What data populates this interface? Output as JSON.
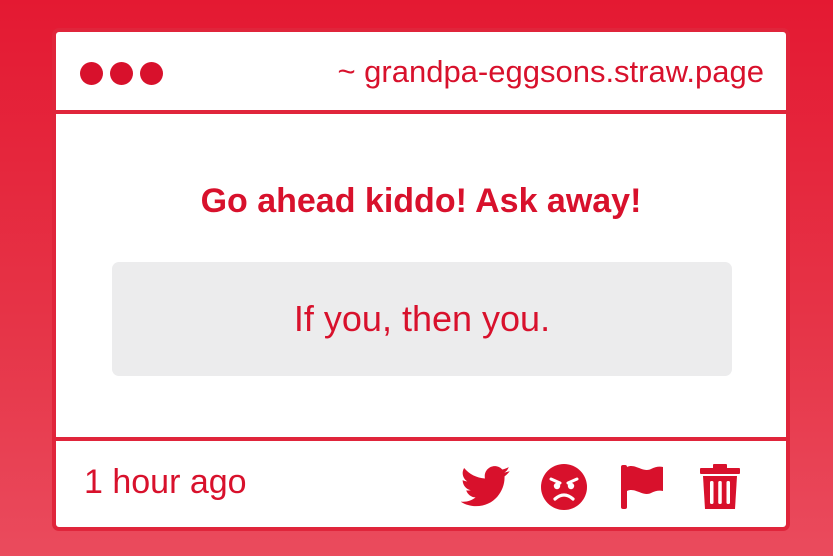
{
  "window": {
    "url": "~ grandpa-eggsons.straw.page",
    "dots": [
      "red",
      "red",
      "red"
    ]
  },
  "main": {
    "prompt": "Go ahead kiddo! Ask away!",
    "question": "If you, then you."
  },
  "footer": {
    "time": "1 hour ago",
    "actions": [
      "twitter-icon",
      "angry-face-icon",
      "flag-icon",
      "trash-icon"
    ]
  },
  "colors": {
    "accent": "#d8112c",
    "border": "#e0253b",
    "question_bg": "#ececed",
    "background": "#e41932"
  }
}
